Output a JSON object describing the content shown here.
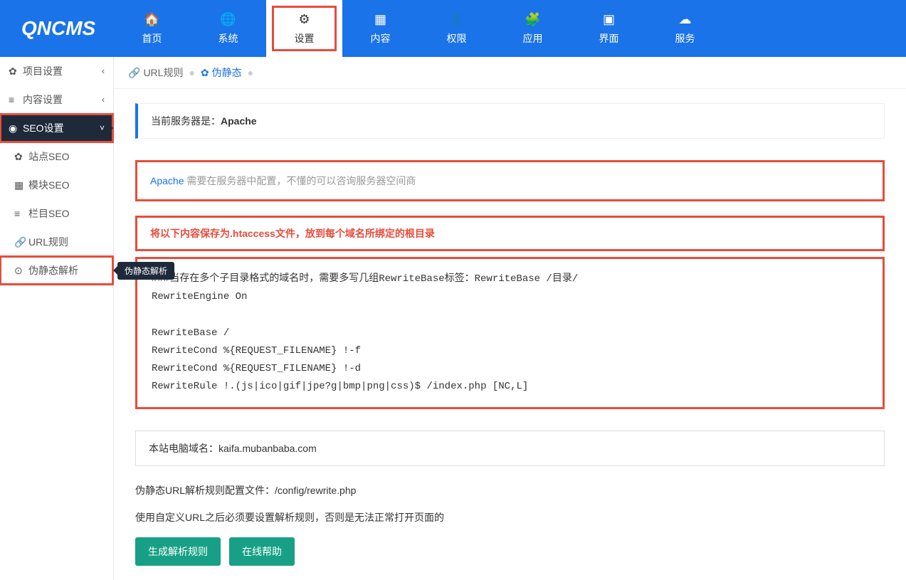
{
  "logo": "QNCMS",
  "navItems": [
    {
      "icon": "🏠",
      "label": "首页"
    },
    {
      "icon": "🌐",
      "label": "系统"
    },
    {
      "icon": "⚙",
      "label": "设置"
    },
    {
      "icon": "▦",
      "label": "内容"
    },
    {
      "icon": "👤",
      "label": "权限"
    },
    {
      "icon": "🧩",
      "label": "应用"
    },
    {
      "icon": "▣",
      "label": "界面"
    },
    {
      "icon": "☁",
      "label": "服务"
    }
  ],
  "sidebar": [
    {
      "icon": "✿",
      "label": "项目设置",
      "chevron": "‹"
    },
    {
      "icon": "≡",
      "label": "内容设置",
      "chevron": "‹"
    },
    {
      "icon": "◉",
      "label": "SEO设置",
      "chevron": "˅"
    },
    {
      "icon": "✿",
      "label": "站点SEO"
    },
    {
      "icon": "▦",
      "label": "模块SEO"
    },
    {
      "icon": "≡",
      "label": "栏目SEO"
    },
    {
      "icon": "🔗",
      "label": "URL规则"
    },
    {
      "icon": "⊙",
      "label": "伪静态解析"
    }
  ],
  "tooltip": "伪静态解析",
  "breadcrumb": {
    "item1": {
      "icon": "🔗",
      "label": "URL规则"
    },
    "item2": {
      "icon": "✿",
      "label": "伪静态"
    }
  },
  "serverInfo": {
    "prefix": "当前服务器是：",
    "server": "Apache"
  },
  "apacheNote": {
    "label": "Apache",
    "text": " 需要在服务器中配置，不懂的可以咨询服务器空间商"
  },
  "warningText": "将以下内容保存为.htaccess文件，放到每个域名所绑定的根目录",
  "codeContent": "###当存在多个子目录格式的域名时，需要多写几组RewriteBase标签：RewriteBase /目录/\nRewriteEngine On\n\nRewriteBase /\nRewriteCond %{REQUEST_FILENAME} !-f\nRewriteCond %{REQUEST_FILENAME} !-d\nRewriteRule !.(js|ico|gif|jpe?g|bmp|png|css)$ /index.php [NC,L]",
  "domainInfo": "本站电脑域名：kaifa.mubanbaba.com",
  "infoLine1": "伪静态URL解析规则配置文件：/config/rewrite.php",
  "infoLine2": "使用自定义URL之后必须要设置解析规则，否则是无法正常打开页面的",
  "buttons": {
    "generate": "生成解析规则",
    "help": "在线帮助"
  }
}
